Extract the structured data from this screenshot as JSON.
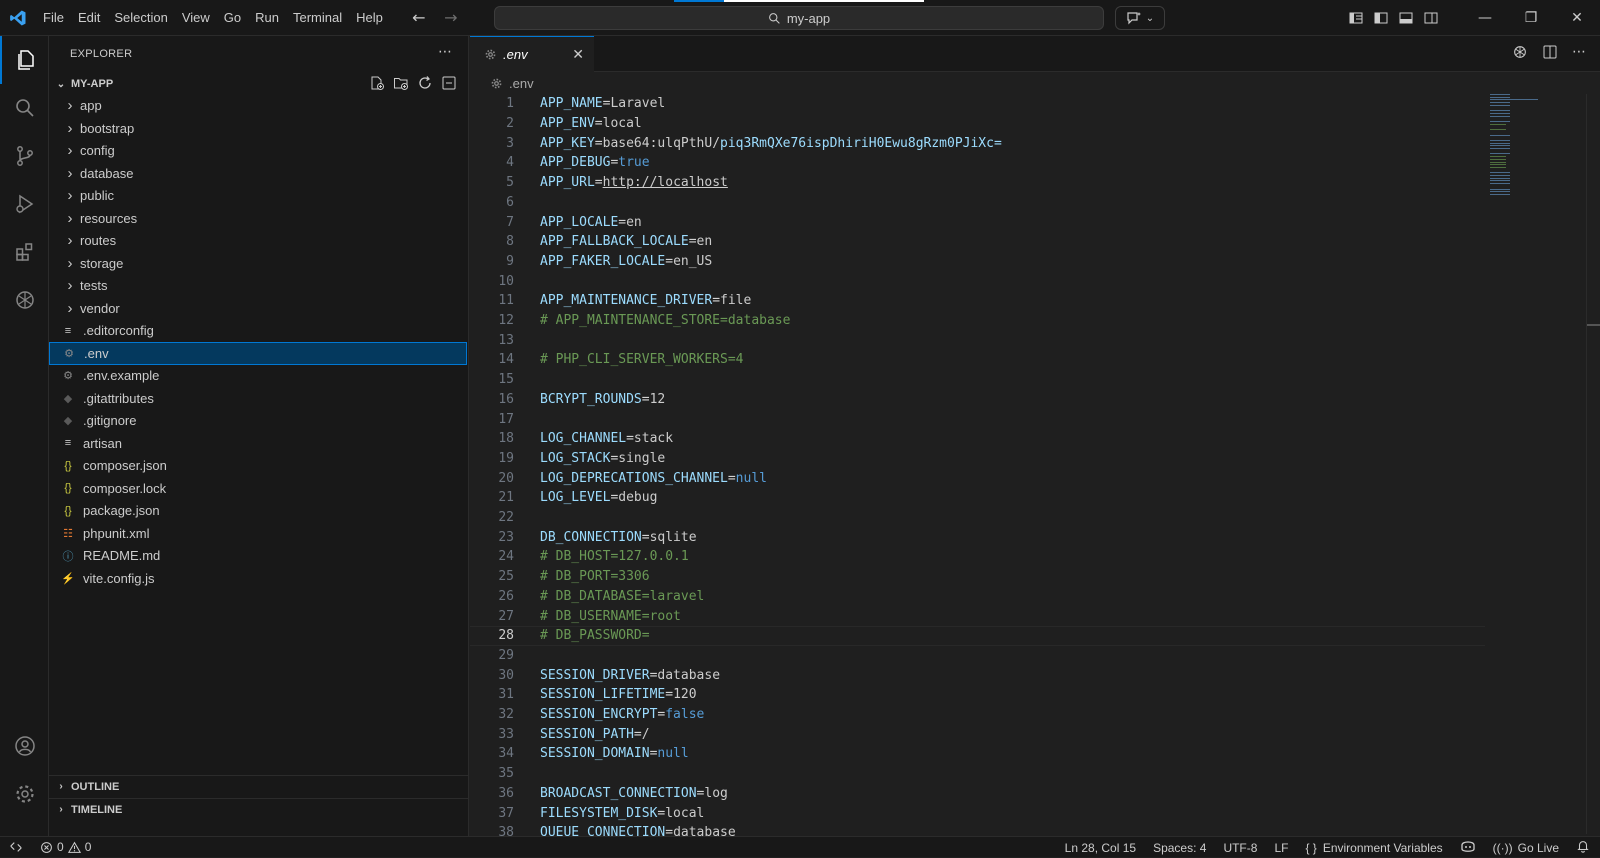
{
  "window": {
    "search_text": "my-app",
    "menu": [
      "File",
      "Edit",
      "Selection",
      "View",
      "Go",
      "Run",
      "Terminal",
      "Help"
    ]
  },
  "sidebar": {
    "title": "EXPLORER",
    "project": "MY-APP",
    "items": [
      {
        "label": "app",
        "type": "folder"
      },
      {
        "label": "bootstrap",
        "type": "folder"
      },
      {
        "label": "config",
        "type": "folder"
      },
      {
        "label": "database",
        "type": "folder"
      },
      {
        "label": "public",
        "type": "folder"
      },
      {
        "label": "resources",
        "type": "folder"
      },
      {
        "label": "routes",
        "type": "folder"
      },
      {
        "label": "storage",
        "type": "folder"
      },
      {
        "label": "tests",
        "type": "folder"
      },
      {
        "label": "vendor",
        "type": "folder"
      },
      {
        "label": ".editorconfig",
        "type": "lines"
      },
      {
        "label": ".env",
        "type": "gear",
        "selected": true
      },
      {
        "label": ".env.example",
        "type": "gear"
      },
      {
        "label": ".gitattributes",
        "type": "git"
      },
      {
        "label": ".gitignore",
        "type": "git"
      },
      {
        "label": "artisan",
        "type": "lines"
      },
      {
        "label": "composer.json",
        "type": "json"
      },
      {
        "label": "composer.lock",
        "type": "json"
      },
      {
        "label": "package.json",
        "type": "json"
      },
      {
        "label": "phpunit.xml",
        "type": "rss"
      },
      {
        "label": "README.md",
        "type": "info"
      },
      {
        "label": "vite.config.js",
        "type": "bolt"
      }
    ],
    "outline": "OUTLINE",
    "timeline": "TIMELINE"
  },
  "editor": {
    "tab_label": ".env",
    "breadcrumb": ".env",
    "current_line": 28,
    "lines": [
      {
        "n": "1",
        "k": "APP_NAME",
        "v": "Laravel",
        "t": "v"
      },
      {
        "n": "2",
        "k": "APP_ENV",
        "v": "local",
        "t": "v"
      },
      {
        "n": "3",
        "k": "APP_KEY",
        "v": "base64:ulqPthU/",
        "v2": "piq3RmQXe76ispDhiriH0Ewu8gRzm0PJiXc=",
        "t": "key"
      },
      {
        "n": "4",
        "k": "APP_DEBUG",
        "v": "true",
        "t": "b"
      },
      {
        "n": "5",
        "k": "APP_URL",
        "v": "http://localhost",
        "t": "u"
      },
      {
        "n": "6",
        "t": "blank"
      },
      {
        "n": "7",
        "k": "APP_LOCALE",
        "v": "en",
        "t": "v"
      },
      {
        "n": "8",
        "k": "APP_FALLBACK_LOCALE",
        "v": "en",
        "t": "v"
      },
      {
        "n": "9",
        "k": "APP_FAKER_LOCALE",
        "v": "en_US",
        "t": "v"
      },
      {
        "n": "10",
        "t": "blank"
      },
      {
        "n": "11",
        "k": "APP_MAINTENANCE_DRIVER",
        "v": "file",
        "t": "v"
      },
      {
        "n": "12",
        "c": "# APP_MAINTENANCE_STORE=database",
        "t": "c"
      },
      {
        "n": "13",
        "t": "blank"
      },
      {
        "n": "14",
        "c": "# PHP_CLI_SERVER_WORKERS=4",
        "t": "c"
      },
      {
        "n": "15",
        "t": "blank"
      },
      {
        "n": "16",
        "k": "BCRYPT_ROUNDS",
        "v": "12",
        "t": "v"
      },
      {
        "n": "17",
        "t": "blank"
      },
      {
        "n": "18",
        "k": "LOG_CHANNEL",
        "v": "stack",
        "t": "v"
      },
      {
        "n": "19",
        "k": "LOG_STACK",
        "v": "single",
        "t": "v"
      },
      {
        "n": "20",
        "k": "LOG_DEPRECATIONS_CHANNEL",
        "v": "null",
        "t": "b"
      },
      {
        "n": "21",
        "k": "LOG_LEVEL",
        "v": "debug",
        "t": "v"
      },
      {
        "n": "22",
        "t": "blank"
      },
      {
        "n": "23",
        "k": "DB_CONNECTION",
        "v": "sqlite",
        "t": "v"
      },
      {
        "n": "24",
        "c": "# DB_HOST=127.0.0.1",
        "t": "c"
      },
      {
        "n": "25",
        "c": "# DB_PORT=3306",
        "t": "c"
      },
      {
        "n": "26",
        "c": "# DB_DATABASE=laravel",
        "t": "c"
      },
      {
        "n": "27",
        "c": "# DB_USERNAME=root",
        "t": "c"
      },
      {
        "n": "28",
        "c": "# DB_PASSWORD=",
        "t": "c"
      },
      {
        "n": "29",
        "t": "blank"
      },
      {
        "n": "30",
        "k": "SESSION_DRIVER",
        "v": "database",
        "t": "v"
      },
      {
        "n": "31",
        "k": "SESSION_LIFETIME",
        "v": "120",
        "t": "v"
      },
      {
        "n": "32",
        "k": "SESSION_ENCRYPT",
        "v": "false",
        "t": "b"
      },
      {
        "n": "33",
        "k": "SESSION_PATH",
        "v": "/",
        "t": "v"
      },
      {
        "n": "34",
        "k": "SESSION_DOMAIN",
        "v": "null",
        "t": "b"
      },
      {
        "n": "35",
        "t": "blank"
      },
      {
        "n": "36",
        "k": "BROADCAST_CONNECTION",
        "v": "log",
        "t": "v"
      },
      {
        "n": "37",
        "k": "FILESYSTEM_DISK",
        "v": "local",
        "t": "v"
      },
      {
        "n": "38",
        "k": "QUEUE_CONNECTION",
        "v": "database",
        "t": "v"
      }
    ]
  },
  "status": {
    "errors": "0",
    "warnings": "0",
    "position": "Ln 28, Col 15",
    "spaces": "Spaces: 4",
    "encoding": "UTF-8",
    "eol": "LF",
    "language": "Environment Variables",
    "golive": "Go Live"
  },
  "colors": {
    "accent": "#0078d4",
    "key": "#9cdcfe",
    "bool": "#569cd6",
    "comment": "#6a9955"
  }
}
